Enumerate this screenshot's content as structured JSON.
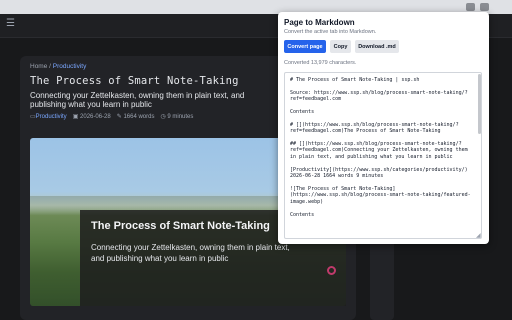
{
  "browser": {
    "extension_icons": [
      "extension-icon",
      "extension-icon"
    ]
  },
  "article": {
    "breadcrumb": {
      "home": "Home",
      "sep": " / ",
      "current": "Productivity"
    },
    "title": "The Process of Smart Note-Taking",
    "subtitle": "Connecting your Zettelkasten, owning them in plain text, and publishing what you learn in public",
    "meta": {
      "category": "Productivity",
      "date": "2026-06-28",
      "words": "1664 words",
      "read_time": "9 minutes"
    },
    "hero": {
      "title": "The Process of Smart Note-Taking",
      "subtitle": "Connecting your Zettelkasten, owning them in plain text, and publishing what you learn in public"
    }
  },
  "popup": {
    "title": "Page to Markdown",
    "description": "Convert the active tab into Markdown.",
    "buttons": {
      "convert": "Convert page",
      "copy": "Copy",
      "download": "Download .md"
    },
    "status": "Converted 13,979 characters.",
    "markdown": "# The Process of Smart Note-Taking | ssp.sh\n\nSource: https://www.ssp.sh/blog/process-smart-note-taking/?ref=feedbagel.com\n\nContents\n\n# [](https://www.ssp.sh/blog/process-smart-note-taking/?ref=feedbagel.com)The Process of Smart Note-Taking\n\n## [](https://www.ssp.sh/blog/process-smart-note-taking/?ref=feedbagel.com)Connecting your Zettelkasten, owning them in plain text, and publishing what you learn in public\n\n[Productivity](https://www.ssp.sh/categories/productivity/) 2026-06-28 1664 words 9 minutes\n\n![The Process of Smart Note-Taking](https://www.ssp.sh/blog/process-smart-note-taking/featured-image.webp)\n\nContents"
  }
}
